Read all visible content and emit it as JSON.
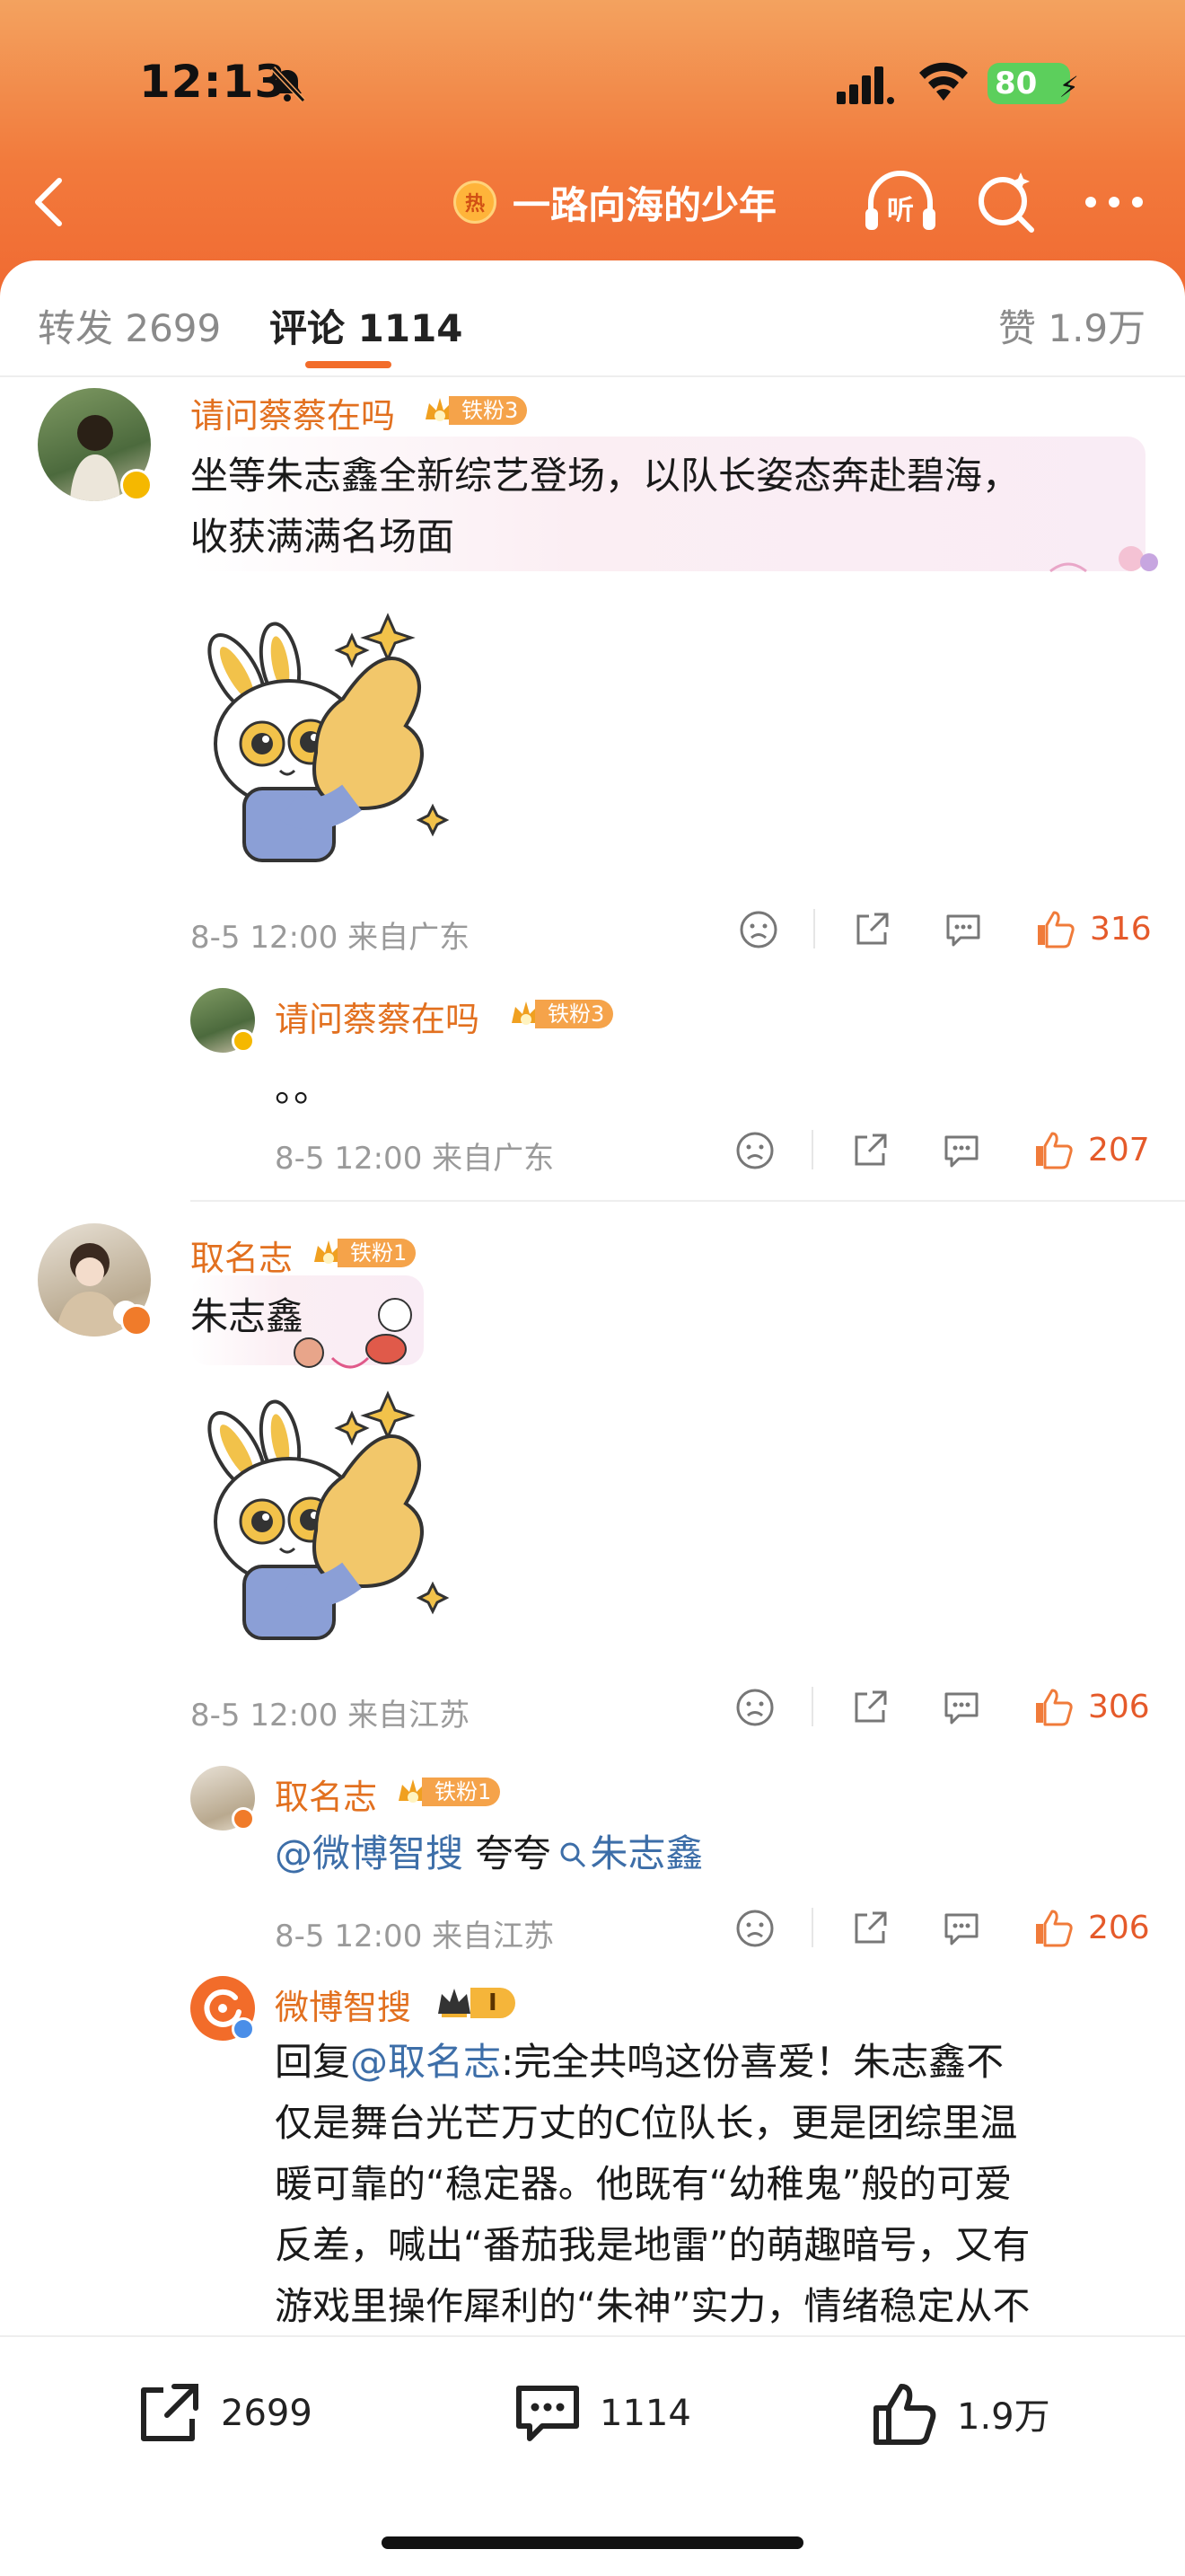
{
  "status_bar": {
    "time": "12:13",
    "battery": "80"
  },
  "header": {
    "title": "一路向海的少年",
    "hot_badge": "热",
    "listen_label": "听"
  },
  "tabs": [
    {
      "label": "转发 2699"
    },
    {
      "label": "评论 1114"
    },
    {
      "label": "赞 1.9万"
    }
  ],
  "comments": [
    {
      "username": "请问蔡蔡在吗",
      "fan_badge": "铁粉3",
      "text": "坐等朱志鑫全新综艺登场，以队长姿态奔赴碧海，收获满满名场面",
      "text_line1": "坐等朱志鑫全新综艺登场，以队长姿态奔赴碧海，",
      "text_line2": "收获满满名场面",
      "meta": "8-5 12:00  来自广东",
      "likes": "316",
      "sticker": "bunny-thumbs-up-sticker"
    },
    {
      "username": "请问蔡蔡在吗",
      "fan_badge": "铁粉3",
      "text": "。。",
      "meta": "8-5 12:00  来自广东",
      "likes": "207",
      "is_reply": true
    },
    {
      "username": "取名志",
      "fan_badge": "铁粉1",
      "text": "朱志鑫",
      "meta": "8-5 12:00  来自江苏",
      "likes": "306",
      "sticker": "bunny-thumbs-up-sticker"
    },
    {
      "username": "取名志",
      "fan_badge": "铁粉1",
      "mention": "@微博智搜",
      "text_mid": " 夸夸",
      "search_link": "朱志鑫",
      "meta": "8-5 12:00  来自江苏",
      "likes": "206",
      "is_reply": true
    },
    {
      "username": "微博智搜",
      "level_badge": "I",
      "reply_prefix": "回复",
      "mention": "@取名志",
      "line1": ":完全共鸣这份喜爱！朱志鑫不",
      "line2": "仅是舞台光芒万丈的C位队长，更是团综里温",
      "line3": "暖可靠的“稳定器。他既有“幼稚鬼”般的可爱",
      "line4": "反差，喊出“番茄我是地雷”的萌趣暗号，又有",
      "line5": "游戏里操作犀利的“朱神”实力，情绪稳定从不",
      "is_reply": true
    }
  ],
  "bottom_bar": {
    "reposts": "2699",
    "comments": "1114",
    "likes": "1.9万"
  },
  "colors": {
    "accent": "#f26c2a",
    "username": "#e2701f",
    "mention": "#3d6ea8",
    "like": "#e55a2a"
  }
}
